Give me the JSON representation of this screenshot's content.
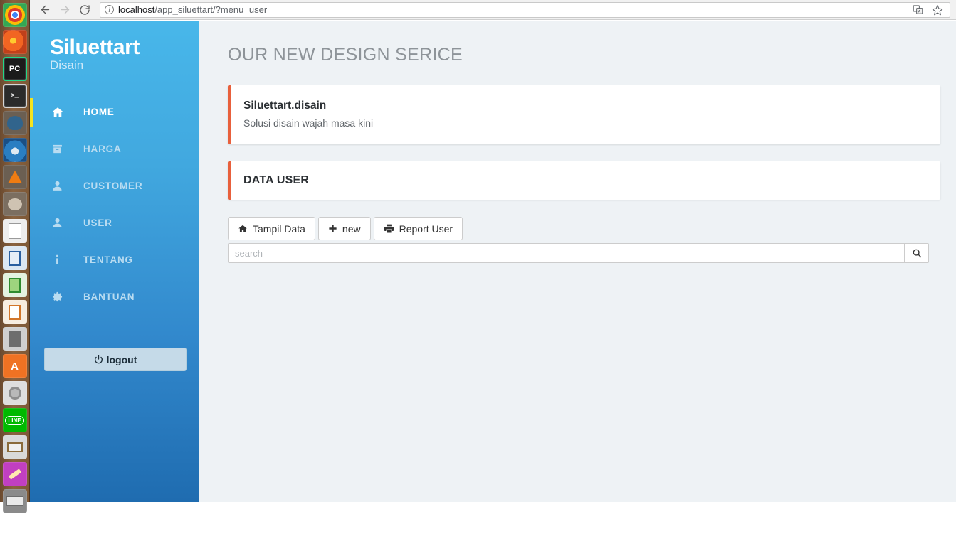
{
  "browser": {
    "back_label": "Back",
    "forward_label": "Forward",
    "reload_label": "Reload",
    "url_host": "localhost",
    "url_path": "/app_siluettart/?menu=user",
    "url_full": "localhost/app_siluettart/?menu=user",
    "info_glyph": "i",
    "translate_label": "Translate this page",
    "bookmark_label": "Bookmark this page"
  },
  "dock": {
    "items": [
      {
        "name": "google-chrome",
        "label": "Chrome"
      },
      {
        "name": "firefox",
        "label": "Firefox"
      },
      {
        "name": "pycharm",
        "label": "PC"
      },
      {
        "name": "terminal",
        "label": "Terminal"
      },
      {
        "name": "postgresql",
        "label": "PostgreSQL"
      },
      {
        "name": "thunderbird",
        "label": "Thunderbird"
      },
      {
        "name": "vlc-media-player",
        "label": "VLC"
      },
      {
        "name": "gimp",
        "label": "GIMP"
      },
      {
        "name": "text-editor",
        "label": "Text Editor"
      },
      {
        "name": "libreoffice-writer",
        "label": "Writer"
      },
      {
        "name": "libreoffice-calc",
        "label": "Calc"
      },
      {
        "name": "libreoffice-impress",
        "label": "Impress"
      },
      {
        "name": "calculator",
        "label": "Calculator"
      },
      {
        "name": "archive-manager",
        "label": "A"
      },
      {
        "name": "system-tools",
        "label": "Tools"
      },
      {
        "name": "line-messenger",
        "label": "LINE"
      },
      {
        "name": "file-archive",
        "label": "Files"
      },
      {
        "name": "paint-app",
        "label": "Paint"
      },
      {
        "name": "scanner",
        "label": "Scanner"
      }
    ]
  },
  "sidebar": {
    "brand_title": "Siluettart",
    "brand_sub": "Disain",
    "items": [
      {
        "label": "HOME",
        "icon": "home-icon",
        "active": true
      },
      {
        "label": "HARGA",
        "icon": "box-icon",
        "active": false
      },
      {
        "label": "CUSTOMER",
        "icon": "user-icon",
        "active": false
      },
      {
        "label": "USER",
        "icon": "user-icon",
        "active": false
      },
      {
        "label": "TENTANG",
        "icon": "info-icon",
        "active": false
      },
      {
        "label": "BANTUAN",
        "icon": "gear-icon",
        "active": false
      }
    ],
    "logout_label": "logout",
    "logout_icon": "power-icon"
  },
  "main": {
    "page_title": "OUR NEW DESIGN SERICE",
    "intro": {
      "title": "Siluettart.disain",
      "subtitle": "Solusi disain wajah masa kini"
    },
    "datauser": {
      "heading": "DATA USER"
    },
    "actions": [
      {
        "label": "Tampil Data",
        "icon": "home-icon"
      },
      {
        "label": "new",
        "icon": "plus-icon"
      },
      {
        "label": "Report User",
        "icon": "printer-icon"
      }
    ],
    "search": {
      "value": "",
      "placeholder": "search",
      "button_icon": "search-icon"
    }
  },
  "colors": {
    "sidebar_top": "#48b7ea",
    "sidebar_bottom": "#1f6cb0",
    "accent_orange": "#e8603c",
    "active_indicator": "#f5e41e",
    "content_bg": "#eef2f5"
  }
}
